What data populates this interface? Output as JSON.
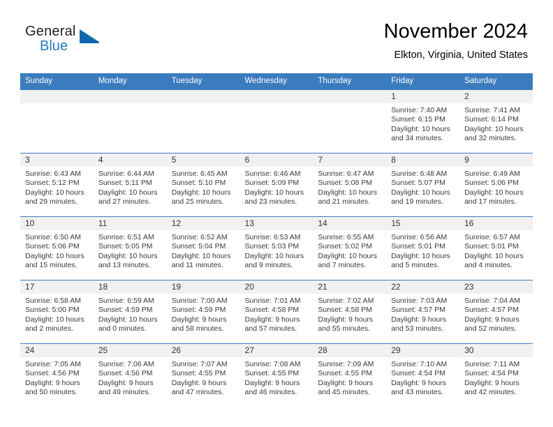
{
  "brand": {
    "name_top": "General",
    "name_bottom": "Blue",
    "logo_icon": "triangle-logo-icon",
    "color_blue": "#1f7bc1",
    "color_dark": "#231f20"
  },
  "header": {
    "month_title": "November 2024",
    "location": "Elkton, Virginia, United States"
  },
  "theme": {
    "header_row_bg": "#3a7cbe",
    "daynum_band_bg": "#f1f1f1",
    "row_border": "#3a7cbe",
    "text": "#3a3a3a"
  },
  "calendar": {
    "weekday_headers": [
      "Sunday",
      "Monday",
      "Tuesday",
      "Wednesday",
      "Thursday",
      "Friday",
      "Saturday"
    ],
    "weeks": [
      [
        {
          "day": "",
          "empty": true,
          "sunrise": "",
          "sunset": "",
          "daylight": ""
        },
        {
          "day": "",
          "empty": true,
          "sunrise": "",
          "sunset": "",
          "daylight": ""
        },
        {
          "day": "",
          "empty": true,
          "sunrise": "",
          "sunset": "",
          "daylight": ""
        },
        {
          "day": "",
          "empty": true,
          "sunrise": "",
          "sunset": "",
          "daylight": ""
        },
        {
          "day": "",
          "empty": true,
          "sunrise": "",
          "sunset": "",
          "daylight": ""
        },
        {
          "day": "1",
          "sunrise": "Sunrise: 7:40 AM",
          "sunset": "Sunset: 6:15 PM",
          "daylight": "Daylight: 10 hours and 34 minutes."
        },
        {
          "day": "2",
          "sunrise": "Sunrise: 7:41 AM",
          "sunset": "Sunset: 6:14 PM",
          "daylight": "Daylight: 10 hours and 32 minutes."
        }
      ],
      [
        {
          "day": "3",
          "sunrise": "Sunrise: 6:43 AM",
          "sunset": "Sunset: 5:12 PM",
          "daylight": "Daylight: 10 hours and 29 minutes."
        },
        {
          "day": "4",
          "sunrise": "Sunrise: 6:44 AM",
          "sunset": "Sunset: 5:11 PM",
          "daylight": "Daylight: 10 hours and 27 minutes."
        },
        {
          "day": "5",
          "sunrise": "Sunrise: 6:45 AM",
          "sunset": "Sunset: 5:10 PM",
          "daylight": "Daylight: 10 hours and 25 minutes."
        },
        {
          "day": "6",
          "sunrise": "Sunrise: 6:46 AM",
          "sunset": "Sunset: 5:09 PM",
          "daylight": "Daylight: 10 hours and 23 minutes."
        },
        {
          "day": "7",
          "sunrise": "Sunrise: 6:47 AM",
          "sunset": "Sunset: 5:08 PM",
          "daylight": "Daylight: 10 hours and 21 minutes."
        },
        {
          "day": "8",
          "sunrise": "Sunrise: 6:48 AM",
          "sunset": "Sunset: 5:07 PM",
          "daylight": "Daylight: 10 hours and 19 minutes."
        },
        {
          "day": "9",
          "sunrise": "Sunrise: 6:49 AM",
          "sunset": "Sunset: 5:06 PM",
          "daylight": "Daylight: 10 hours and 17 minutes."
        }
      ],
      [
        {
          "day": "10",
          "sunrise": "Sunrise: 6:50 AM",
          "sunset": "Sunset: 5:06 PM",
          "daylight": "Daylight: 10 hours and 15 minutes."
        },
        {
          "day": "11",
          "sunrise": "Sunrise: 6:51 AM",
          "sunset": "Sunset: 5:05 PM",
          "daylight": "Daylight: 10 hours and 13 minutes."
        },
        {
          "day": "12",
          "sunrise": "Sunrise: 6:52 AM",
          "sunset": "Sunset: 5:04 PM",
          "daylight": "Daylight: 10 hours and 11 minutes."
        },
        {
          "day": "13",
          "sunrise": "Sunrise: 6:53 AM",
          "sunset": "Sunset: 5:03 PM",
          "daylight": "Daylight: 10 hours and 9 minutes."
        },
        {
          "day": "14",
          "sunrise": "Sunrise: 6:55 AM",
          "sunset": "Sunset: 5:02 PM",
          "daylight": "Daylight: 10 hours and 7 minutes."
        },
        {
          "day": "15",
          "sunrise": "Sunrise: 6:56 AM",
          "sunset": "Sunset: 5:01 PM",
          "daylight": "Daylight: 10 hours and 5 minutes."
        },
        {
          "day": "16",
          "sunrise": "Sunrise: 6:57 AM",
          "sunset": "Sunset: 5:01 PM",
          "daylight": "Daylight: 10 hours and 4 minutes."
        }
      ],
      [
        {
          "day": "17",
          "sunrise": "Sunrise: 6:58 AM",
          "sunset": "Sunset: 5:00 PM",
          "daylight": "Daylight: 10 hours and 2 minutes."
        },
        {
          "day": "18",
          "sunrise": "Sunrise: 6:59 AM",
          "sunset": "Sunset: 4:59 PM",
          "daylight": "Daylight: 10 hours and 0 minutes."
        },
        {
          "day": "19",
          "sunrise": "Sunrise: 7:00 AM",
          "sunset": "Sunset: 4:59 PM",
          "daylight": "Daylight: 9 hours and 58 minutes."
        },
        {
          "day": "20",
          "sunrise": "Sunrise: 7:01 AM",
          "sunset": "Sunset: 4:58 PM",
          "daylight": "Daylight: 9 hours and 57 minutes."
        },
        {
          "day": "21",
          "sunrise": "Sunrise: 7:02 AM",
          "sunset": "Sunset: 4:58 PM",
          "daylight": "Daylight: 9 hours and 55 minutes."
        },
        {
          "day": "22",
          "sunrise": "Sunrise: 7:03 AM",
          "sunset": "Sunset: 4:57 PM",
          "daylight": "Daylight: 9 hours and 53 minutes."
        },
        {
          "day": "23",
          "sunrise": "Sunrise: 7:04 AM",
          "sunset": "Sunset: 4:57 PM",
          "daylight": "Daylight: 9 hours and 52 minutes."
        }
      ],
      [
        {
          "day": "24",
          "sunrise": "Sunrise: 7:05 AM",
          "sunset": "Sunset: 4:56 PM",
          "daylight": "Daylight: 9 hours and 50 minutes."
        },
        {
          "day": "25",
          "sunrise": "Sunrise: 7:06 AM",
          "sunset": "Sunset: 4:56 PM",
          "daylight": "Daylight: 9 hours and 49 minutes."
        },
        {
          "day": "26",
          "sunrise": "Sunrise: 7:07 AM",
          "sunset": "Sunset: 4:55 PM",
          "daylight": "Daylight: 9 hours and 47 minutes."
        },
        {
          "day": "27",
          "sunrise": "Sunrise: 7:08 AM",
          "sunset": "Sunset: 4:55 PM",
          "daylight": "Daylight: 9 hours and 46 minutes."
        },
        {
          "day": "28",
          "sunrise": "Sunrise: 7:09 AM",
          "sunset": "Sunset: 4:55 PM",
          "daylight": "Daylight: 9 hours and 45 minutes."
        },
        {
          "day": "29",
          "sunrise": "Sunrise: 7:10 AM",
          "sunset": "Sunset: 4:54 PM",
          "daylight": "Daylight: 9 hours and 43 minutes."
        },
        {
          "day": "30",
          "sunrise": "Sunrise: 7:11 AM",
          "sunset": "Sunset: 4:54 PM",
          "daylight": "Daylight: 9 hours and 42 minutes."
        }
      ]
    ]
  }
}
